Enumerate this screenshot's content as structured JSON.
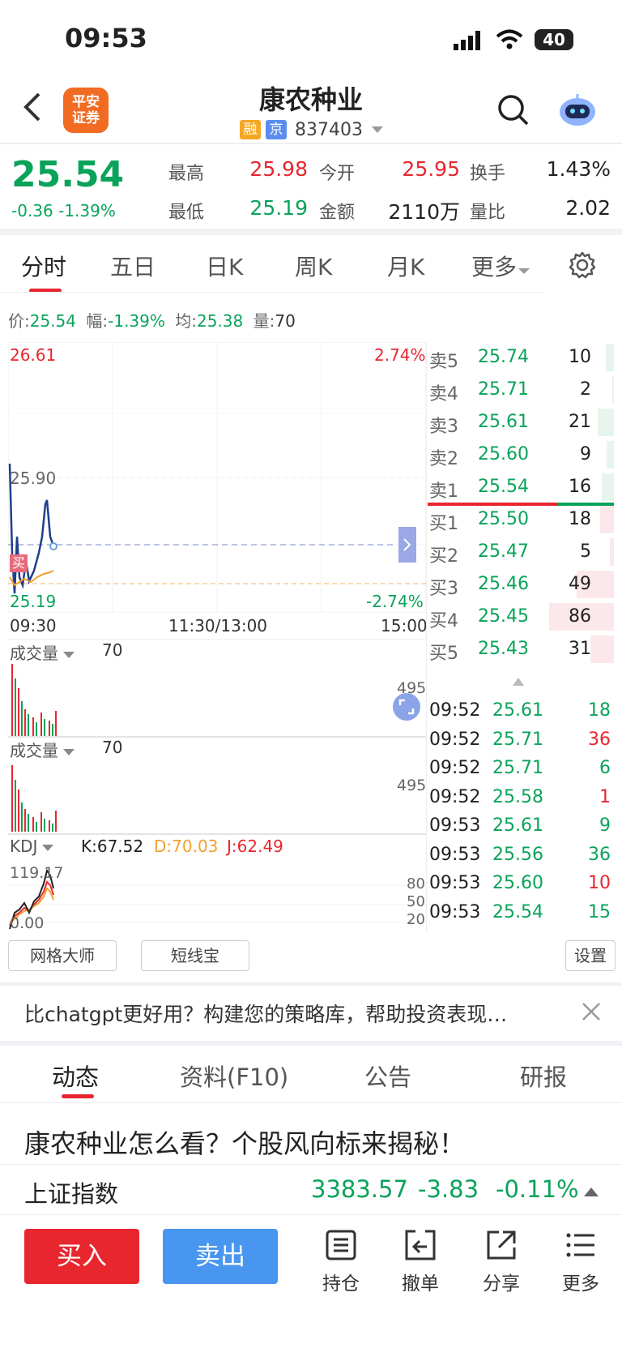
{
  "status": {
    "time": "09:53",
    "battery": "40"
  },
  "header": {
    "logo_line1": "平安",
    "logo_line2": "证券",
    "title": "康农种业",
    "tag1": "融",
    "tag2": "京",
    "code": "837403"
  },
  "quote": {
    "price": "25.54",
    "change": "-0.36 -1.39%",
    "high_label": "最高",
    "high": "25.98",
    "open_label": "今开",
    "open": "25.95",
    "turnover_label": "换手",
    "turnover": "1.43%",
    "low_label": "最低",
    "low": "25.19",
    "amount_label": "金额",
    "amount": "2110万",
    "ratio_label": "量比",
    "ratio": "2.02"
  },
  "tabs": [
    "分时",
    "五日",
    "日K",
    "周K",
    "月K",
    "更多"
  ],
  "infoline": {
    "p_label": "价:",
    "p": "25.54",
    "f_label": "幅:",
    "f": "-1.39%",
    "a_label": "均:",
    "a": "25.38",
    "v_label": "量:",
    "v": "70"
  },
  "chart": {
    "top_price": "26.61",
    "top_pct": "2.74%",
    "mid_price": "25.90",
    "bottom_price": "25.19",
    "bottom_pct": "-2.74%",
    "buy_marker": "买",
    "t_start": "09:30",
    "t_mid": "11:30/13:00",
    "t_end": "15:00"
  },
  "orderbook": [
    {
      "label": "卖5",
      "price": "25.74",
      "vol": "10",
      "bar": 0.12
    },
    {
      "label": "卖4",
      "price": "25.71",
      "vol": "2",
      "bar": 0.03
    },
    {
      "label": "卖3",
      "price": "25.61",
      "vol": "21",
      "bar": 0.25
    },
    {
      "label": "卖2",
      "price": "25.60",
      "vol": "9",
      "bar": 0.11
    },
    {
      "label": "卖1",
      "price": "25.54",
      "vol": "16",
      "bar": 0.19
    },
    {
      "label": "买1",
      "price": "25.50",
      "vol": "18",
      "bar": 0.21
    },
    {
      "label": "买2",
      "price": "25.47",
      "vol": "5",
      "bar": 0.06
    },
    {
      "label": "买3",
      "price": "25.46",
      "vol": "49",
      "bar": 0.57
    },
    {
      "label": "买4",
      "price": "25.45",
      "vol": "86",
      "bar": 1.0
    },
    {
      "label": "买5",
      "price": "25.43",
      "vol": "31",
      "bar": 0.36
    }
  ],
  "volume1": {
    "title": "成交量",
    "value": "70",
    "max": "495"
  },
  "volume2": {
    "title": "成交量",
    "value": "70",
    "max": "495"
  },
  "kdj": {
    "title": "KDJ",
    "k": "K:67.52",
    "d": "D:70.03",
    "j": "J:62.49",
    "top": "119.17",
    "bottom": "0.00",
    "l80": "80",
    "l50": "50",
    "l20": "20"
  },
  "ticks": [
    {
      "time": "09:52",
      "price": "25.61",
      "vol": "18",
      "dir": "green"
    },
    {
      "time": "09:52",
      "price": "25.71",
      "vol": "36",
      "dir": "red"
    },
    {
      "time": "09:52",
      "price": "25.71",
      "vol": "6",
      "dir": "green"
    },
    {
      "time": "09:52",
      "price": "25.58",
      "vol": "1",
      "dir": "red"
    },
    {
      "time": "09:53",
      "price": "25.61",
      "vol": "9",
      "dir": "green"
    },
    {
      "time": "09:53",
      "price": "25.56",
      "vol": "36",
      "dir": "green"
    },
    {
      "time": "09:53",
      "price": "25.60",
      "vol": "10",
      "dir": "red"
    },
    {
      "time": "09:53",
      "price": "25.54",
      "vol": "15",
      "dir": "green"
    }
  ],
  "tools": {
    "grid": "网格大师",
    "short": "短线宝",
    "settings": "设置"
  },
  "ad": "比chatgpt更好用？构建您的策略库，帮助投资表现…",
  "ftabs": [
    "动态",
    "资料(F10)",
    "公告",
    "研报"
  ],
  "news": "康农种业怎么看？个股风向标来揭秘！",
  "index": {
    "name": "上证指数",
    "value": "3383.57",
    "change": "-3.83",
    "pct": "-0.11%"
  },
  "bottom": {
    "buy": "买入",
    "sell": "卖出",
    "hold": "持仓",
    "cancel": "撤单",
    "share": "分享",
    "more": "更多"
  }
}
